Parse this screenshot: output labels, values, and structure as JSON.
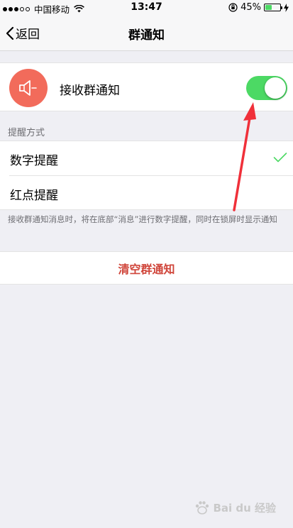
{
  "status_bar": {
    "carrier": "中国移动",
    "time": "13:47",
    "battery": "45%",
    "battery_level": 0.45
  },
  "nav": {
    "back_label": "返回",
    "title": "群通知"
  },
  "receive": {
    "label": "接收群通知",
    "enabled": true,
    "toggle_color": "#4cd964",
    "avatar_color": "#f26b5b",
    "avatar_icon": "speaker-icon"
  },
  "reminder": {
    "section_title": "提醒方式",
    "options": [
      {
        "label": "数字提醒",
        "selected": true
      },
      {
        "label": "红点提醒",
        "selected": false
      }
    ],
    "footnote": "接收群通知消息时，将在底部“消息”进行数字提醒，同时在锁屏时显示通知"
  },
  "clear_button": {
    "label": "清空群通知",
    "color": "#d0463b"
  },
  "watermark": {
    "text": "Bai du 经验"
  },
  "colors": {
    "background": "#efeff4",
    "annotation": "#f0303a",
    "check": "#4cd964"
  }
}
